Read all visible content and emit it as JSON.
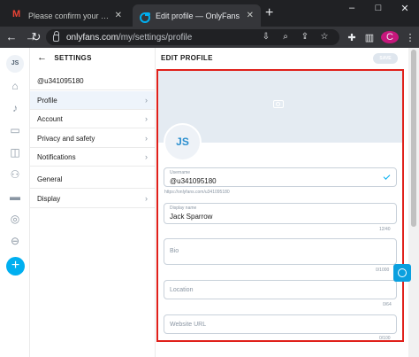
{
  "browser": {
    "tabs": [
      {
        "title": "Please confirm your e-mail a",
        "active": false,
        "icon": "gmail-icon"
      },
      {
        "title": "Edit profile — OnlyFans",
        "active": true,
        "icon": "onlyfans-icon"
      }
    ],
    "url_host": "onlyfans.com",
    "url_path": "/my/settings/profile",
    "profile_initial": "C",
    "window_controls": {
      "minimize": "–",
      "maximize": "□",
      "close": "✕"
    }
  },
  "sidebar": {
    "avatar_initials": "JS"
  },
  "settings": {
    "title": "SETTINGS",
    "username": "@u341095180",
    "items": [
      {
        "label": "Profile",
        "active": true
      },
      {
        "label": "Account"
      },
      {
        "label": "Privacy and safety"
      },
      {
        "label": "Notifications"
      }
    ],
    "sections": [
      "General",
      "Display"
    ]
  },
  "edit_profile": {
    "title": "EDIT PROFILE",
    "save_label": "SAVE",
    "avatar_initials": "JS",
    "username_label": "Username",
    "username_value": "@u341095180",
    "profile_url_hint": "https://onlyfans.com/u341095180",
    "display_name_label": "Display name",
    "display_name_value": "Jack Sparrow",
    "display_name_counter": "12/40",
    "bio_placeholder": "Bio",
    "bio_counter": "0/1000",
    "location_placeholder": "Location",
    "location_counter": "0/64",
    "website_placeholder": "Website URL",
    "website_counter": "0/100"
  },
  "colors": {
    "accent": "#00aff0",
    "highlight_border": "#e0201a",
    "cover": "#e4ebf2"
  }
}
